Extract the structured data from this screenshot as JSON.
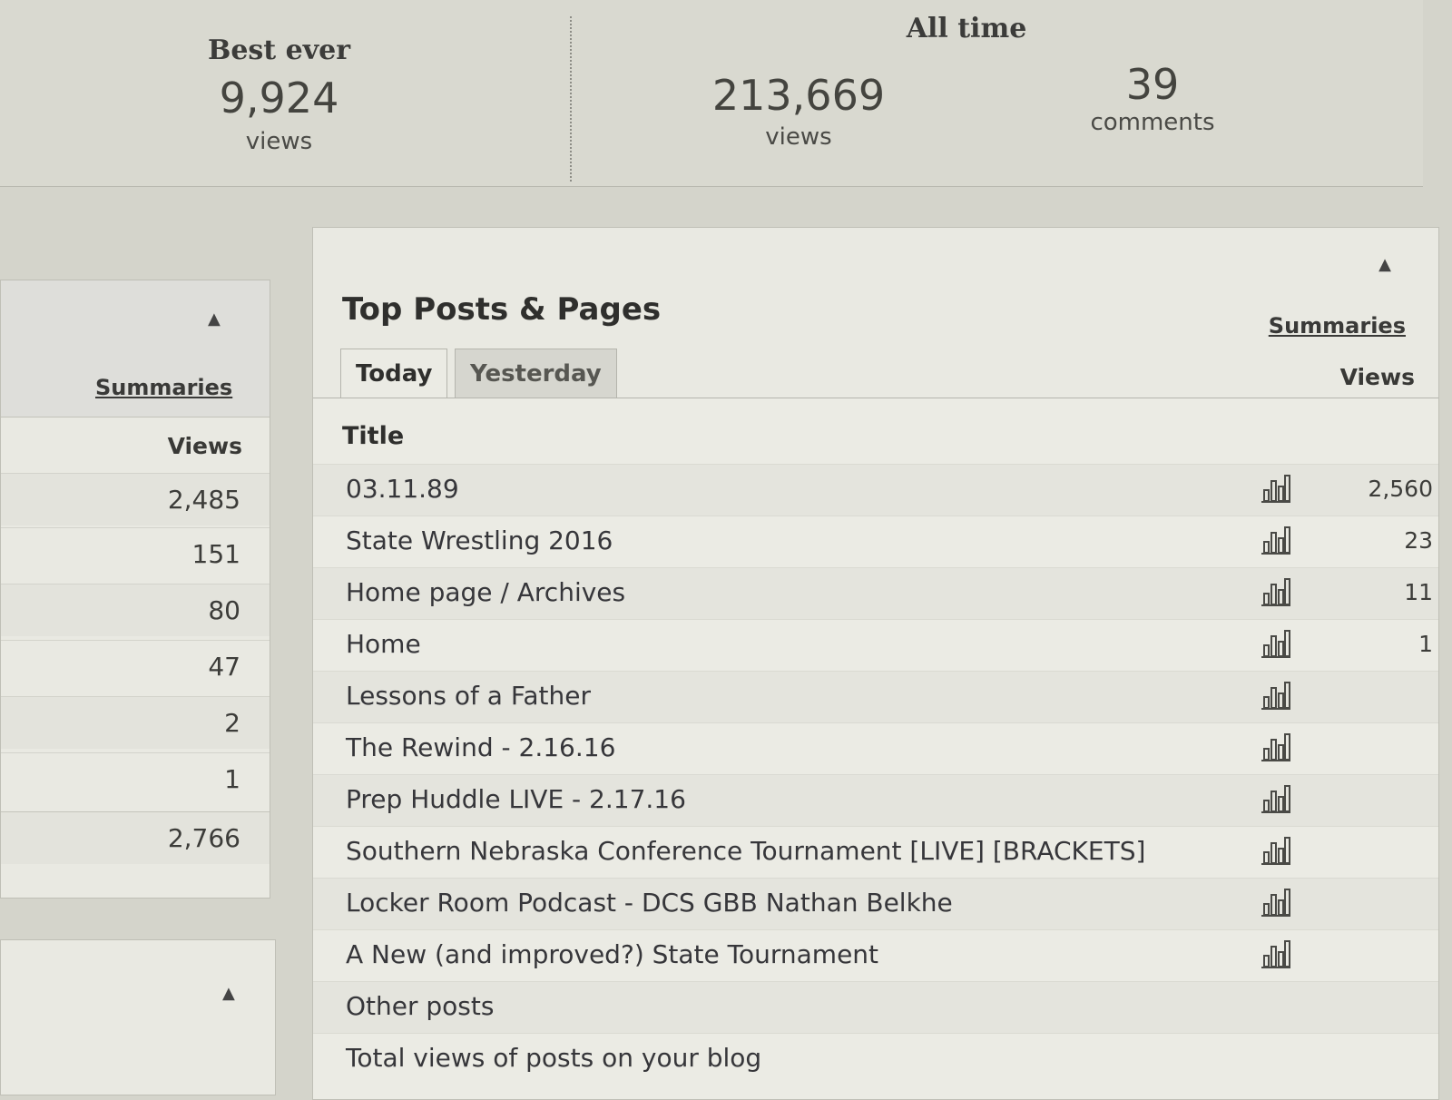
{
  "stats": {
    "best_ever": {
      "title": "Best ever",
      "number": "9,924",
      "unit": "views"
    },
    "all_time": {
      "title": "All time",
      "views": {
        "number": "213,669",
        "unit": "views"
      },
      "comments": {
        "number": "39",
        "unit": "comments"
      }
    }
  },
  "left_panel": {
    "summaries_label": "Summaries",
    "views_header": "Views",
    "values": [
      "2,485",
      "151",
      "80",
      "47",
      "2",
      "1"
    ],
    "total": "2,766"
  },
  "top_posts": {
    "title": "Top Posts & Pages",
    "summaries_label": "Summaries",
    "tabs": [
      {
        "label": "Today",
        "active": true
      },
      {
        "label": "Yesterday",
        "active": false
      }
    ],
    "title_header": "Title",
    "views_header": "Views",
    "rows": [
      {
        "title": "03.11.89",
        "views": "2,560",
        "icon": "bar-chart-icon"
      },
      {
        "title": "State Wrestling 2016",
        "views": "23",
        "icon": "bar-chart-icon"
      },
      {
        "title": "Home page / Archives",
        "views": "11",
        "icon": "bar-chart-icon"
      },
      {
        "title": "Home",
        "views": "1",
        "icon": "bar-chart-icon"
      },
      {
        "title": "Lessons of a Father",
        "views": "",
        "icon": "bar-chart-icon"
      },
      {
        "title": "The Rewind - 2.16.16",
        "views": "",
        "icon": "bar-chart-icon"
      },
      {
        "title": "Prep Huddle LIVE - 2.17.16",
        "views": "",
        "icon": "bar-chart-icon"
      },
      {
        "title": "Southern Nebraska Conference Tournament [LIVE] [BRACKETS]",
        "views": "",
        "icon": "bar-chart-icon"
      },
      {
        "title": "Locker Room Podcast - DCS GBB Nathan Belkhe",
        "views": "",
        "icon": "bar-chart-icon"
      },
      {
        "title": "A New (and improved?) State Tournament",
        "views": "",
        "icon": "bar-chart-icon"
      },
      {
        "title": "Other posts",
        "views": "",
        "icon": ""
      },
      {
        "title": "Total views of posts on your blog",
        "views": "",
        "icon": ""
      }
    ]
  },
  "colors": {
    "background": "#d4d4cb",
    "panel": "#e9e9e2",
    "text": "#3a3a38"
  }
}
